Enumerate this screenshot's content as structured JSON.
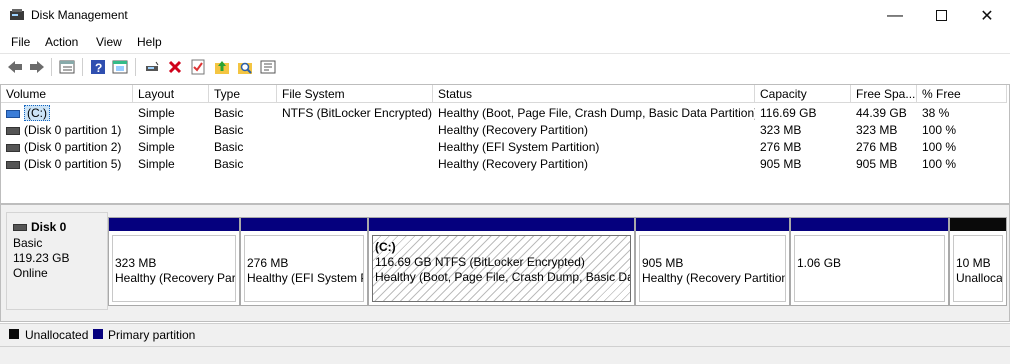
{
  "window": {
    "title": "Disk Management"
  },
  "menu": [
    "File",
    "Action",
    "View",
    "Help"
  ],
  "toolbar_icons": [
    "back-arrow-icon",
    "forward-arrow-icon",
    "list-view-icon",
    "help-icon",
    "properties-icon",
    "connect-icon",
    "delete-icon",
    "check-icon",
    "up-folder-icon",
    "search-folder-icon",
    "settings-icon"
  ],
  "volume_table": {
    "columns": [
      "Volume",
      "Layout",
      "Type",
      "File System",
      "Status",
      "Capacity",
      "Free Spa...",
      "% Free"
    ],
    "rows": [
      [
        "(C:)",
        "Simple",
        "Basic",
        "NTFS (BitLocker Encrypted)",
        "Healthy (Boot, Page File, Crash Dump, Basic Data Partition)",
        "116.69 GB",
        "44.39 GB",
        "38 %"
      ],
      [
        "(Disk 0 partition 1)",
        "Simple",
        "Basic",
        "",
        "Healthy (Recovery Partition)",
        "323 MB",
        "323 MB",
        "100 %"
      ],
      [
        "(Disk 0 partition 2)",
        "Simple",
        "Basic",
        "",
        "Healthy (EFI System Partition)",
        "276 MB",
        "276 MB",
        "100 %"
      ],
      [
        "(Disk 0 partition 5)",
        "Simple",
        "Basic",
        "",
        "Healthy (Recovery Partition)",
        "905 MB",
        "905 MB",
        "100 %"
      ]
    ]
  },
  "disk": {
    "name": "Disk 0",
    "type": "Basic",
    "size": "119.23 GB",
    "state": "Online"
  },
  "partitions": [
    {
      "line0": "",
      "line1": "323 MB",
      "line2": "Healthy (Recovery Partition)",
      "kind": "primary"
    },
    {
      "line0": "",
      "line1": "276 MB",
      "line2": "Healthy (EFI System Partition)",
      "kind": "primary"
    },
    {
      "line0": "(C:)",
      "line1": "116.69 GB NTFS (BitLocker Encrypted)",
      "line2": "Healthy (Boot, Page File, Crash Dump, Basic Data Partition)",
      "kind": "primary-selected"
    },
    {
      "line0": "",
      "line1": "905 MB",
      "line2": "Healthy (Recovery Partition)",
      "kind": "primary"
    },
    {
      "line0": "",
      "line1": "1.06 GB",
      "line2": "",
      "kind": "primary"
    },
    {
      "line0": "",
      "line1": "10 MB",
      "line2": "Unallocated",
      "kind": "unallocated"
    }
  ],
  "legend": [
    {
      "label": "Unallocated",
      "color": "#0a0a0a"
    },
    {
      "label": "Primary partition",
      "color": "#05007e"
    }
  ],
  "colors": {
    "primary": "#05007e",
    "unallocated": "#0a0a0a",
    "selection": "#cce4f7"
  }
}
